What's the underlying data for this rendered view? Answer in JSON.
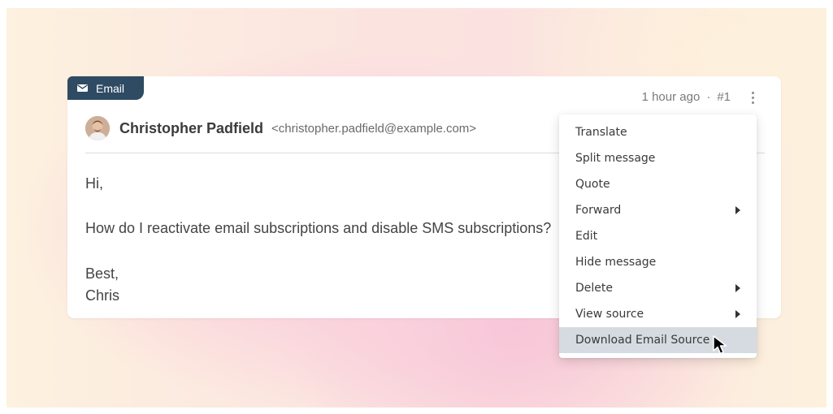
{
  "tag": {
    "label": "Email",
    "icon": "envelope-icon",
    "color": "#2f4b63"
  },
  "meta": {
    "time": "1 hour ago",
    "separator": "·",
    "number": "#1"
  },
  "sender": {
    "name": "Christopher Padfield",
    "email": "<christopher.padfield@example.com>"
  },
  "message": {
    "greeting": "Hi,",
    "body": "How do I reactivate email subscriptions and disable SMS subscriptions?",
    "closing": "Best,",
    "signature": "Chris"
  },
  "menu": {
    "items": [
      {
        "label": "Translate",
        "submenu": false
      },
      {
        "label": "Split message",
        "submenu": false
      },
      {
        "label": "Quote",
        "submenu": false
      },
      {
        "label": "Forward",
        "submenu": true
      },
      {
        "label": "Edit",
        "submenu": false
      },
      {
        "label": "Hide message",
        "submenu": false
      },
      {
        "label": "Delete",
        "submenu": true
      },
      {
        "label": "View source",
        "submenu": true
      },
      {
        "label": "Download Email Source",
        "submenu": false,
        "highlighted": true
      }
    ]
  },
  "colors": {
    "highlight": "#d5dbe1",
    "accent": "#2f4b63"
  }
}
